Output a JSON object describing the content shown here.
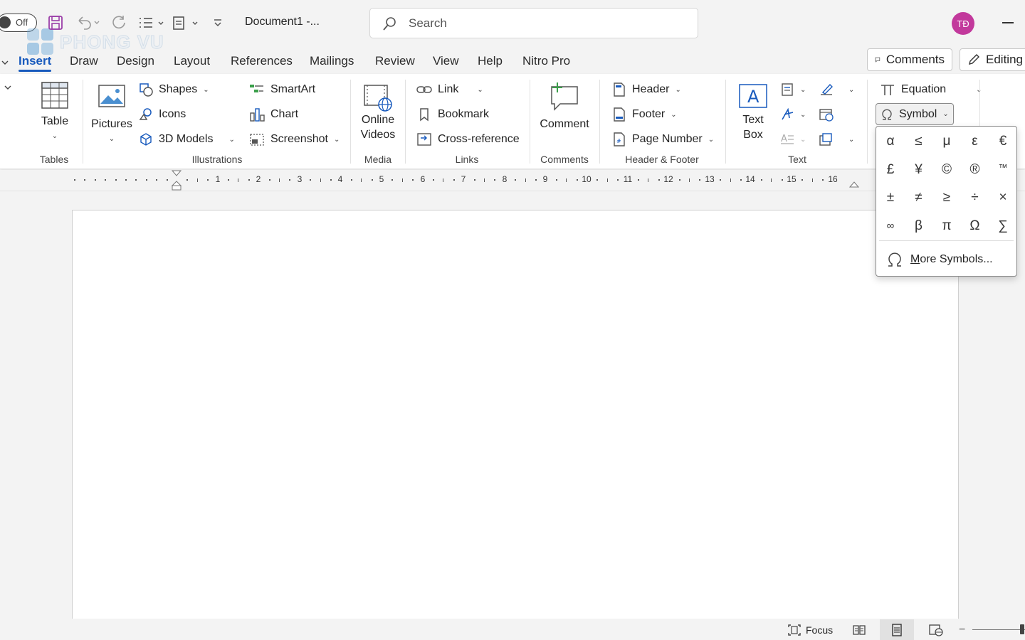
{
  "titlebar": {
    "autosave_label": "Off",
    "document_title": "Document1  -...",
    "search_placeholder": "Search",
    "avatar_initials": "TĐ",
    "watermark": "PHONG VU"
  },
  "tabs": [
    {
      "label": ""
    },
    {
      "label": "Insert"
    },
    {
      "label": "Draw"
    },
    {
      "label": "Design"
    },
    {
      "label": "Layout"
    },
    {
      "label": "References"
    },
    {
      "label": "Mailings"
    },
    {
      "label": "Review"
    },
    {
      "label": "View"
    },
    {
      "label": "Help"
    },
    {
      "label": "Nitro Pro"
    }
  ],
  "top_buttons": {
    "comments": "Comments",
    "editing": "Editing"
  },
  "ribbon": {
    "tables": {
      "table": "Table",
      "group": "Tables"
    },
    "illustrations": {
      "pictures": "Pictures",
      "shapes": "Shapes",
      "icons": "Icons",
      "models": "3D Models",
      "smartart": "SmartArt",
      "chart": "Chart",
      "screenshot": "Screenshot",
      "group": "Illustrations"
    },
    "media": {
      "online_videos_1": "Online",
      "online_videos_2": "Videos",
      "group": "Media"
    },
    "links": {
      "link": "Link",
      "bookmark": "Bookmark",
      "crossref": "Cross-reference",
      "group": "Links"
    },
    "comments": {
      "comment": "Comment",
      "group": "Comments"
    },
    "header_footer": {
      "header": "Header",
      "footer": "Footer",
      "page_number": "Page Number",
      "group": "Header & Footer"
    },
    "text": {
      "textbox_1": "Text",
      "textbox_2": "Box",
      "group": "Text"
    },
    "symbols": {
      "equation": "Equation",
      "symbol": "Symbol"
    }
  },
  "ruler": {
    "numbers": [
      "1",
      "2",
      "3",
      "4",
      "5",
      "6",
      "7",
      "8",
      "9",
      "10",
      "11",
      "12",
      "13",
      "14",
      "15",
      "16"
    ]
  },
  "symbol_panel": {
    "symbols": [
      "α",
      "≤",
      "μ",
      "ε",
      "€",
      "£",
      "¥",
      "©",
      "®",
      "™",
      "±",
      "≠",
      "≥",
      "÷",
      "×",
      "∞",
      "β",
      "π",
      "Ω",
      "∑"
    ],
    "more": "More Symbols..."
  },
  "statusbar": {
    "focus": "Focus"
  },
  "colors": {
    "accent": "#185abd",
    "avatar": "#c2399c",
    "save_icon": "#9b3fa8"
  }
}
